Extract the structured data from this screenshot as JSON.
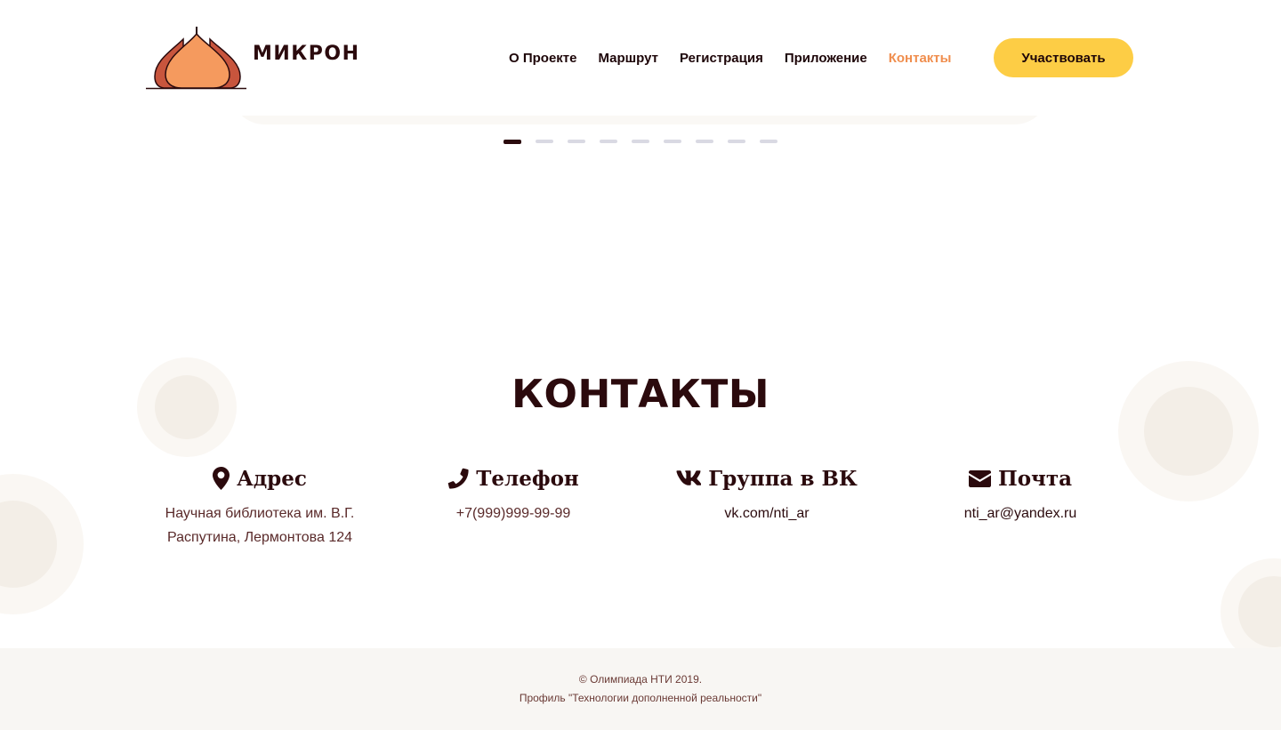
{
  "brand": {
    "name": "МИКРОН",
    "colors": {
      "dome_fill": "#f59a5e",
      "dome_side": "#c8553d",
      "outline": "#2b0a0d"
    }
  },
  "nav": {
    "items": [
      {
        "label": "О Проекте",
        "active": false
      },
      {
        "label": "Маршрут",
        "active": false
      },
      {
        "label": "Регистрация",
        "active": false
      },
      {
        "label": "Приложение",
        "active": false
      },
      {
        "label": "Контакты",
        "active": true
      }
    ],
    "accent_color": "#f08e4e"
  },
  "cta": {
    "label": "Участвовать",
    "color": "#fdcd45"
  },
  "slider": {
    "dot_count": 9,
    "active_index": 0
  },
  "contacts": {
    "title": "КОНТАКТЫ",
    "items": [
      {
        "icon": "map-marker-icon",
        "label": "Адрес",
        "value_lines": [
          "Научная библиотека им. В.Г.",
          "Распутина, Лермонтова 124"
        ]
      },
      {
        "icon": "phone-icon",
        "label": "Телефон",
        "value_lines": [
          "+7(999)999-99-99"
        ]
      },
      {
        "icon": "vk-icon",
        "label": "Группа в ВК",
        "value_lines": [
          "vk.com/nti_ar"
        ]
      },
      {
        "icon": "envelope-icon",
        "label": "Почта",
        "value_lines": [
          "nti_ar@yandex.ru"
        ]
      }
    ]
  },
  "footer": {
    "line1": "© Олимпиада НТИ 2019.",
    "line2": "Профиль \"Технологии дополненной реальности\""
  }
}
